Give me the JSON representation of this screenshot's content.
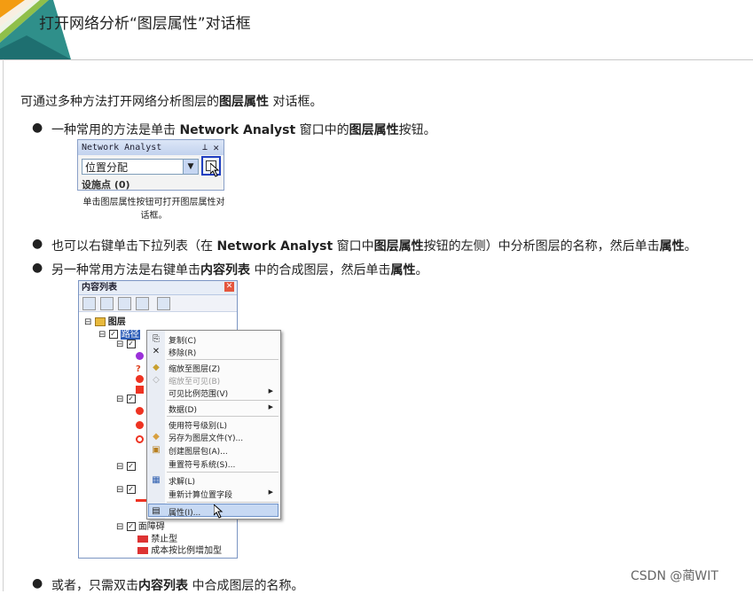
{
  "header": {
    "title": "打开网络分析“图层属性”对话框"
  },
  "intro": {
    "text_a": "可通过多种方法打开网络分析图层的",
    "bold": "图层属性",
    "text_b": " 对话框。"
  },
  "bullets": [
    {
      "a": "一种常用的方法是单击 ",
      "b1": "Network Analyst",
      "c": " 窗口中的",
      "b2": "图层属性",
      "d": "按钮。"
    },
    {
      "a": "也可以右键单击下拉列表（在 ",
      "b1": "Network Analyst",
      "c": " 窗口中",
      "b2": "图层属性",
      "d": "按钮的左侧）中分析图层的名称，然后单击",
      "b3": "属性",
      "e": "。"
    },
    {
      "a": "另一种常用方法是右键单击",
      "b1": "内容列表",
      "c": " 中的合成图层，然后单击",
      "b2": "属性",
      "d": "。"
    },
    {
      "a": "或者，只需双击",
      "b1": "内容列表",
      "c": " 中合成图层的名称。"
    }
  ],
  "na_window": {
    "title": "Network Analyst",
    "pin_icon": "pin-icon",
    "close_icon": "close-icon",
    "combo_value": "位置分配",
    "cut_text": "   设施点 (0)",
    "caption": "单击图层属性按钮可打开图层属性对话框。"
  },
  "toc": {
    "title": "内容列表",
    "layers_label": "图层",
    "group_label": "路径",
    "barrier_label": "面障碍",
    "barrier_items": [
      "禁止型",
      "成本按比例增加型"
    ]
  },
  "context_menu": {
    "items": [
      {
        "label": "复制(C)",
        "icon": "copy-icon"
      },
      {
        "label": "移除(R)",
        "icon": "remove-icon"
      },
      {
        "label": "缩放至图层(Z)",
        "icon": "zoom-layer-icon"
      },
      {
        "label": "缩放至可见(B)",
        "icon": "zoom-visible-icon",
        "disabled": true
      },
      {
        "label": "可见比例范围(V)",
        "submenu": true
      },
      {
        "label": "数据(D)",
        "submenu": true
      },
      {
        "label": "使用符号级别(L)"
      },
      {
        "label": "另存为图层文件(Y)...",
        "icon": "save-layer-icon"
      },
      {
        "label": "创建图层包(A)...",
        "icon": "layer-package-icon"
      },
      {
        "label": "重置符号系统(S)..."
      },
      {
        "label": "求解(L)",
        "icon": "solve-icon"
      },
      {
        "label": "重新计算位置字段",
        "submenu": true
      },
      {
        "label": "属性(I)...",
        "icon": "properties-icon",
        "highlighted": true
      }
    ]
  },
  "watermark": "CSDN @蔺WIT",
  "colors": {
    "accent_orange": "#f39c12",
    "accent_green": "#6fae3a",
    "accent_teal": "#1f8a8a",
    "highlight": "#c7d9f3"
  }
}
